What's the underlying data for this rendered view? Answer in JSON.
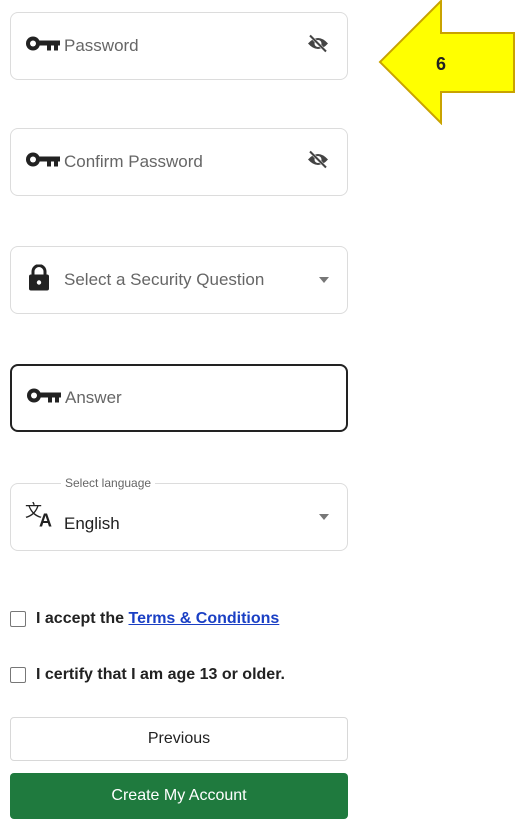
{
  "password": {
    "placeholder": "Password",
    "key_icon": "key-icon",
    "visibility_icon": "eye-off-icon"
  },
  "confirm_password": {
    "placeholder": "Confirm Password",
    "key_icon": "key-icon",
    "visibility_icon": "eye-off-icon"
  },
  "security_question": {
    "placeholder": "Select a Security Question",
    "icon": "lock-icon"
  },
  "answer": {
    "placeholder": "Answer",
    "icon": "key-icon"
  },
  "language": {
    "legend": "Select language",
    "value": "English",
    "icon": "translate-icon"
  },
  "terms": {
    "prefix": "I accept the ",
    "link": "Terms & Conditions"
  },
  "age": {
    "label": "I certify that I am age 13 or older."
  },
  "buttons": {
    "previous": "Previous",
    "create": "Create My Account"
  },
  "callout": {
    "number": "6",
    "color": "#ffff00",
    "border": "#c9a300"
  },
  "colors": {
    "primary": "#1f7a3e",
    "link": "#1a3fc4"
  }
}
